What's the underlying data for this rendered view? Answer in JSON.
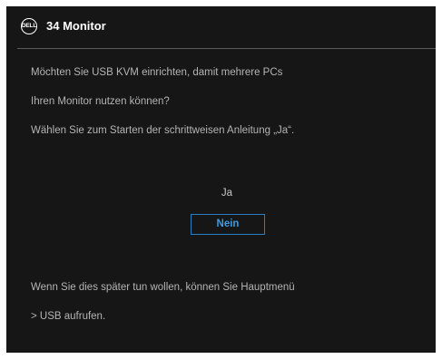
{
  "header": {
    "logo_text": "DELL",
    "title": "34 Monitor"
  },
  "message": {
    "line1": "Möchten Sie USB KVM einrichten, damit mehrere PCs",
    "line2": "Ihren Monitor nutzen können?",
    "line3": "Wählen Sie zum Starten der schrittweisen Anleitung „Ja“."
  },
  "options": {
    "yes": "Ja",
    "no": "Nein",
    "selected": "Nein"
  },
  "footer": {
    "line1": "Wenn Sie dies später tun wollen, können Sie Hauptmenü",
    "line2": "> USB aufrufen."
  },
  "colors": {
    "background": "#161616",
    "text": "#b4b4b4",
    "accent": "#2a7fc4"
  }
}
